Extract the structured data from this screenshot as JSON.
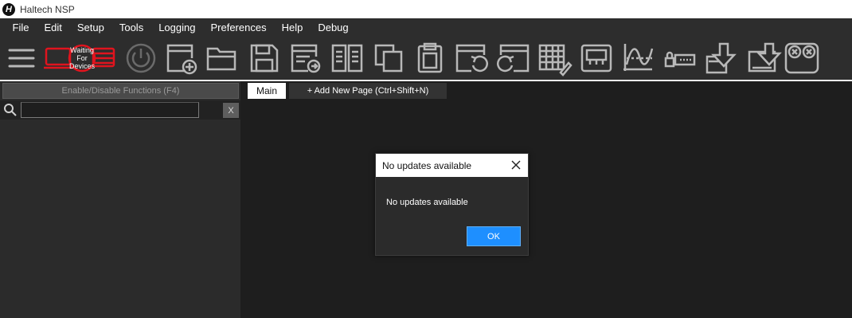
{
  "window": {
    "title": "Haltech NSP",
    "logo_letter": "H"
  },
  "menu": {
    "items": [
      "File",
      "Edit",
      "Setup",
      "Tools",
      "Logging",
      "Preferences",
      "Help",
      "Debug"
    ]
  },
  "toolbar": {
    "status_badge": {
      "line1": "Waiting",
      "line2": "For",
      "line3": "Devices"
    },
    "colors": {
      "icon": "#b8b8b8",
      "alert": "#e0141e"
    },
    "icons": [
      "hamburger-menu-icon",
      "ecu-connect-icon",
      "power-icon",
      "new-project-icon",
      "open-folder-icon",
      "save-icon",
      "export-icon",
      "compare-icon",
      "copy-icon",
      "paste-icon",
      "undo-icon",
      "redo-icon",
      "table-edit-icon",
      "dashboard-icon",
      "graph-icon",
      "key-icon",
      "download-ecu-icon",
      "upload-ecu-icon",
      "tape-icon"
    ]
  },
  "left_panel": {
    "enable_disable_label": "Enable/Disable Functions (F4)",
    "search": {
      "value": "",
      "placeholder": ""
    },
    "clear_label": "X"
  },
  "tabs": [
    {
      "label": "Main",
      "active": true
    },
    {
      "label": "+ Add New Page (Ctrl+Shift+N)",
      "active": false
    }
  ],
  "dialog": {
    "title": "No updates available",
    "message": "No updates available",
    "ok_label": "OK",
    "colors": {
      "ok_button": "#1e8fff"
    }
  }
}
